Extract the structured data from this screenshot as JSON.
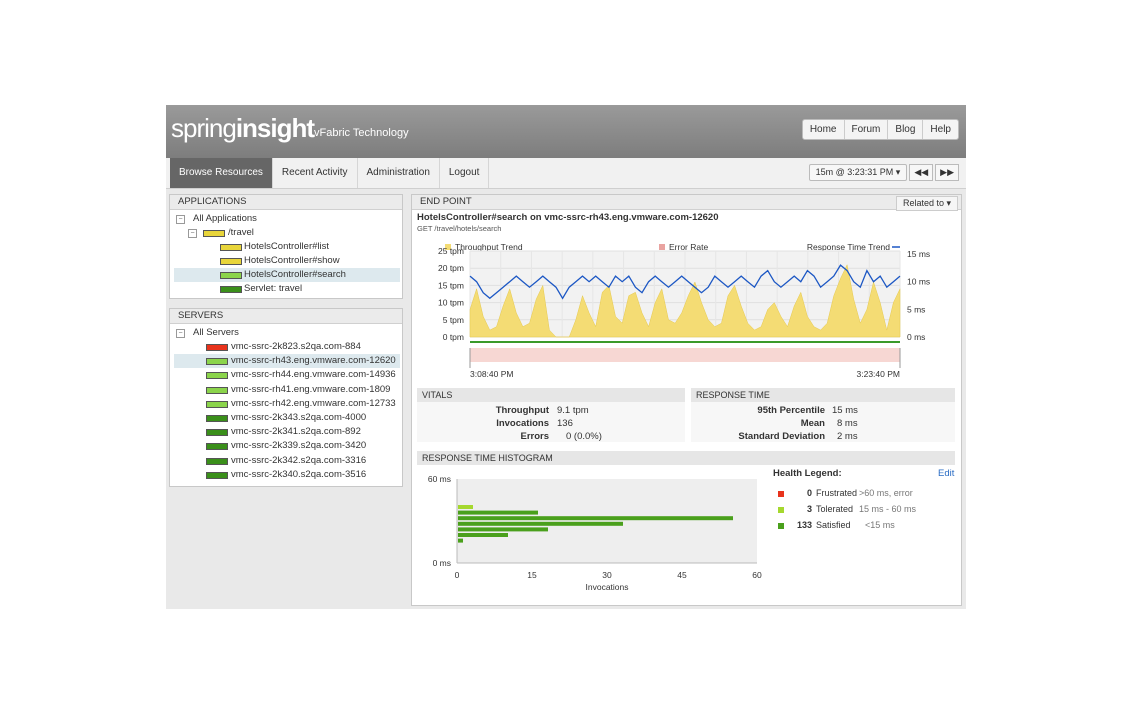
{
  "header": {
    "logo_part1": "spring",
    "logo_part2": "insight",
    "tagline": "vFabric Technology",
    "links": [
      "Home",
      "Forum",
      "Blog",
      "Help"
    ]
  },
  "nav": {
    "tabs": [
      "Browse Resources",
      "Recent Activity",
      "Administration",
      "Logout"
    ],
    "active": "Browse Resources",
    "time_select": "15m @ 3:23:31 PM ▾",
    "prev_btn": "◀◀",
    "next_btn": "▶▶"
  },
  "applications": {
    "title": "APPLICATIONS",
    "root": "All Applications",
    "app": "/travel",
    "children": [
      {
        "label": "HotelsController#list",
        "health": "yellow"
      },
      {
        "label": "HotelsController#show",
        "health": "yellow"
      },
      {
        "label": "HotelsController#search",
        "health": "green-light",
        "selected": true
      },
      {
        "label": "Servlet: travel",
        "health": "green"
      }
    ]
  },
  "servers": {
    "title": "SERVERS",
    "root": "All Servers",
    "items": [
      {
        "label": "vmc-ssrc-2k823.s2qa.com-884",
        "health": "red"
      },
      {
        "label": "vmc-ssrc-rh43.eng.vmware.com-12620",
        "health": "green-light",
        "selected": true
      },
      {
        "label": "vmc-ssrc-rh44.eng.vmware.com-14936",
        "health": "green-light"
      },
      {
        "label": "vmc-ssrc-rh41.eng.vmware.com-1809",
        "health": "green-light"
      },
      {
        "label": "vmc-ssrc-rh42.eng.vmware.com-12733",
        "health": "green-light"
      },
      {
        "label": "vmc-ssrc-2k343.s2qa.com-4000",
        "health": "green"
      },
      {
        "label": "vmc-ssrc-2k341.s2qa.com-892",
        "health": "green"
      },
      {
        "label": "vmc-ssrc-2k339.s2qa.com-3420",
        "health": "green"
      },
      {
        "label": "vmc-ssrc-2k342.s2qa.com-3316",
        "health": "green"
      },
      {
        "label": "vmc-ssrc-2k340.s2qa.com-3516",
        "health": "green"
      }
    ]
  },
  "endpoint": {
    "title": "END POINT",
    "related_to": "Related to ▾",
    "name": "HotelsController#search on vmc-ssrc-rh43.eng.vmware.com-12620",
    "path": "GET /travel/hotels/search"
  },
  "trend_chart": {
    "legend_throughput": "Throughput Trend",
    "legend_error": "Error Rate",
    "legend_response": "Response Time Trend",
    "y_left_ticks": [
      "25 tpm",
      "20 tpm",
      "15 tpm",
      "10 tpm",
      "5 tpm",
      "0 tpm"
    ],
    "y_right_ticks": [
      "15 ms",
      "10 ms",
      "5 ms",
      "0 ms"
    ],
    "x_start": "3:08:40 PM",
    "x_end": "3:23:40 PM"
  },
  "vitals": {
    "title": "VITALS",
    "throughput_label": "Throughput",
    "throughput_value": "9.1 tpm",
    "invocations_label": "Invocations",
    "invocations_value": "136",
    "errors_label": "Errors",
    "errors_value": "0 (0.0%)"
  },
  "response_time": {
    "title": "RESPONSE TIME",
    "p95_label": "95th Percentile",
    "p95_value": "15 ms",
    "mean_label": "Mean",
    "mean_value": "8 ms",
    "std_label": "Standard Deviation",
    "std_value": "2 ms"
  },
  "histogram": {
    "title": "RESPONSE TIME HISTOGRAM",
    "xlabel": "Invocations"
  },
  "health_legend": {
    "title": "Health Legend:",
    "edit": "Edit",
    "frustrated_count": "0",
    "frustrated_label": "Frustrated",
    "frustrated_desc": ">60 ms, error",
    "tolerated_count": "3",
    "tolerated_label": "Tolerated",
    "tolerated_desc": "15 ms - 60 ms",
    "satisfied_count": "133",
    "satisfied_label": "Satisfied",
    "satisfied_desc": "<15 ms"
  },
  "colors": {
    "red": "#e8331c",
    "yellow": "#e8d53a",
    "green_light": "#8bd44b",
    "green": "#3a8f1a",
    "throughput_fill": "#f4dc74",
    "response_line": "#1c57c4",
    "error_fill": "#f7d7d3",
    "satisfied": "#4aa01c",
    "tolerated": "#a5d82e"
  },
  "chart_data": {
    "type": "bar",
    "orientation": "horizontal",
    "xlabel": "Invocations",
    "xlim": [
      0,
      60
    ],
    "x_ticks": [
      0,
      15,
      30,
      45,
      60
    ],
    "y_ticks": [
      "60 ms",
      "0 ms"
    ],
    "ylim": [
      0,
      60
    ],
    "series": [
      {
        "name": "Tolerated",
        "color": "#a5d82e",
        "bars": [
          {
            "bucket_ms": 40,
            "invocations": 3
          }
        ]
      },
      {
        "name": "Satisfied",
        "color": "#4aa01c",
        "bars": [
          {
            "bucket_ms": 36,
            "invocations": 16
          },
          {
            "bucket_ms": 32,
            "invocations": 55
          },
          {
            "bucket_ms": 28,
            "invocations": 33
          },
          {
            "bucket_ms": 24,
            "invocations": 18
          },
          {
            "bucket_ms": 20,
            "invocations": 10
          },
          {
            "bucket_ms": 16,
            "invocations": 1
          }
        ]
      }
    ]
  }
}
